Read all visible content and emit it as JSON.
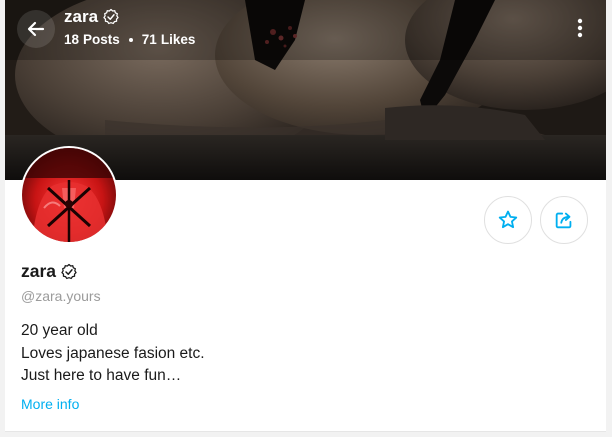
{
  "header": {
    "name": "zara",
    "posts_count": "18",
    "posts_label": "Posts",
    "likes_count": "71",
    "likes_label": "Likes"
  },
  "profile": {
    "name": "zara",
    "handle": "@zara.yours",
    "bio_lines": [
      "20 year old",
      "Loves japanese fasion etc.",
      "Just here to have fun…"
    ],
    "more_info_label": "More info"
  },
  "icons": {
    "back": "arrow-left-icon",
    "verified": "verified-badge-icon",
    "more": "more-vertical-icon",
    "favorite": "star-icon",
    "share": "share-icon"
  },
  "colors": {
    "accent": "#00aff0",
    "text": "#1a1a1a",
    "muted": "#9b9b9b"
  }
}
